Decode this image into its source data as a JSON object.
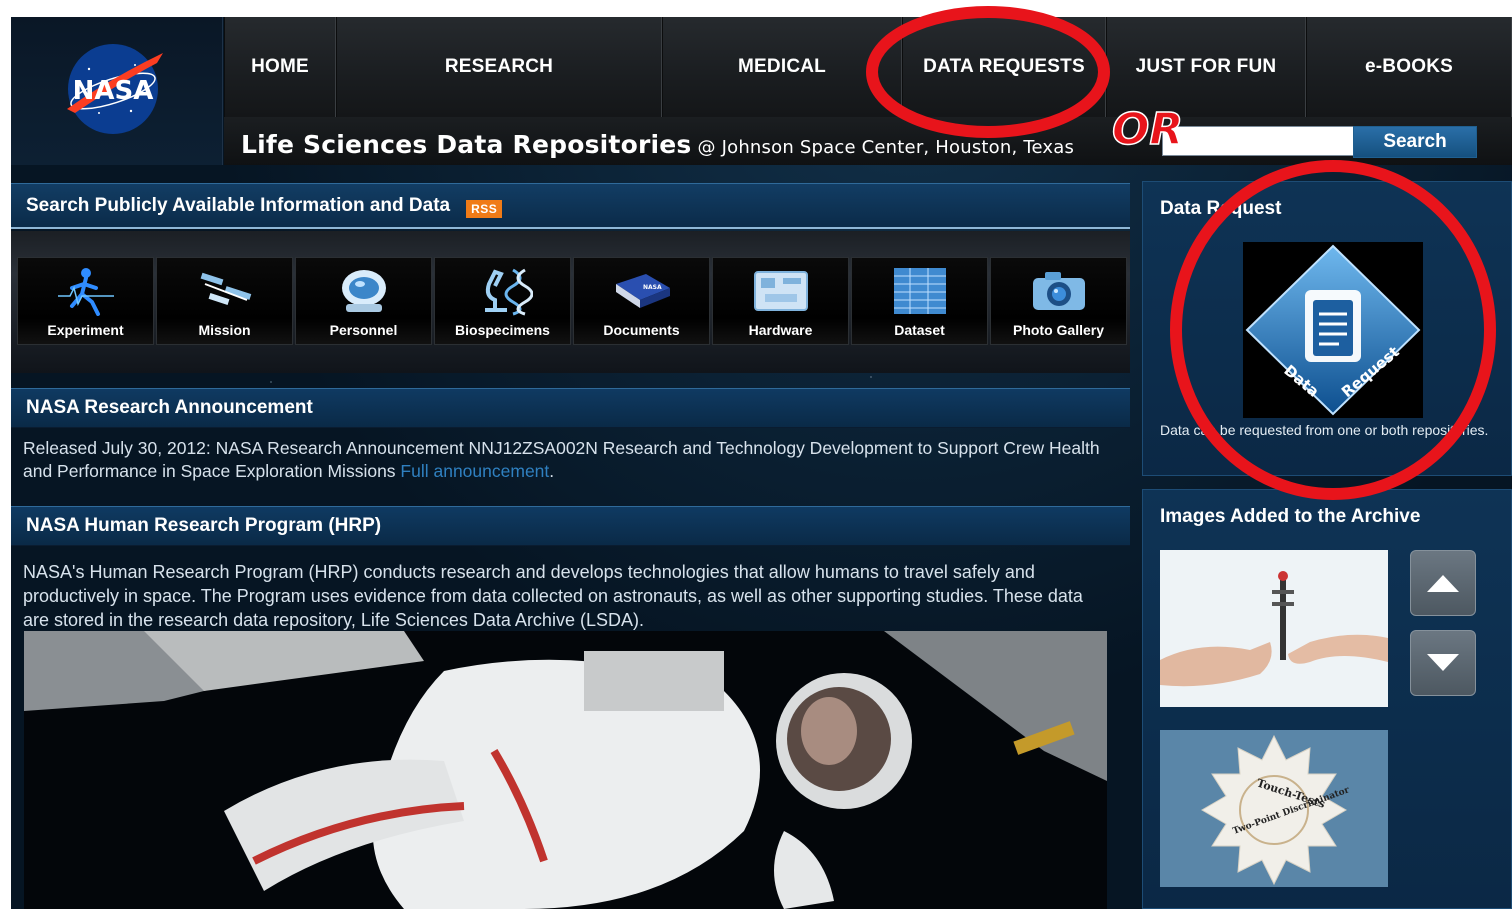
{
  "nav": {
    "home": "HOME",
    "research": "RESEARCH",
    "medical": "MEDICAL",
    "data_requests": "DATA REQUESTS",
    "just_for_fun": "JUST FOR FUN",
    "ebooks": "e-BOOKS"
  },
  "header": {
    "logo_text": "NASA",
    "title": "Life Sciences Data Repositories",
    "subtitle": "@ Johnson Space Center, Houston, Texas",
    "search_value": "",
    "search_button": "Search"
  },
  "search_section": {
    "title": "Search Publicly Available Information and Data",
    "rss": "RSS",
    "categories": [
      {
        "label": "Experiment",
        "icon": "running-figure-icon"
      },
      {
        "label": "Mission",
        "icon": "space-station-icon"
      },
      {
        "label": "Personnel",
        "icon": "astronaut-helmet-icon"
      },
      {
        "label": "Biospecimens",
        "icon": "microscope-dna-icon"
      },
      {
        "label": "Documents",
        "icon": "book-icon"
      },
      {
        "label": "Hardware",
        "icon": "circuit-board-icon"
      },
      {
        "label": "Dataset",
        "icon": "spreadsheet-icon"
      },
      {
        "label": "Photo Gallery",
        "icon": "camera-icon"
      }
    ]
  },
  "nra": {
    "title": "NASA Research Announcement",
    "body": "Released July 30, 2012: NASA Research Announcement NNJ12ZSA002N Research and Technology Development to Support Crew Health and Performance in Space Exploration Missions ",
    "link": "Full announcement",
    "tail": "."
  },
  "hrp": {
    "title": "NASA Human Research Program (HRP)",
    "body": "NASA's Human Research Program (HRP) conducts research and develops technologies that allow humans to travel safely and productively in space. The Program uses evidence from data collected on astronauts, as well as other supporting studies. These data are stored in the research data repository, Life Sciences Data Archive (LSDA)."
  },
  "data_request": {
    "title": "Data Request",
    "icon_word_1": "Data",
    "icon_word_2": "Request",
    "text": "Data can be requested from one or both repositories."
  },
  "archive": {
    "title": "Images Added to the Archive",
    "thumb2_line1": "Touch-Tests",
    "thumb2_line2": "Two-Point Discriminator"
  },
  "annotation": {
    "or_text": "OR",
    "color": "#e8141b"
  },
  "colors": {
    "bg": "#061523",
    "section_blue": "#0f3a62",
    "link_blue": "#2f80c0",
    "rss_orange": "#f07b17"
  }
}
